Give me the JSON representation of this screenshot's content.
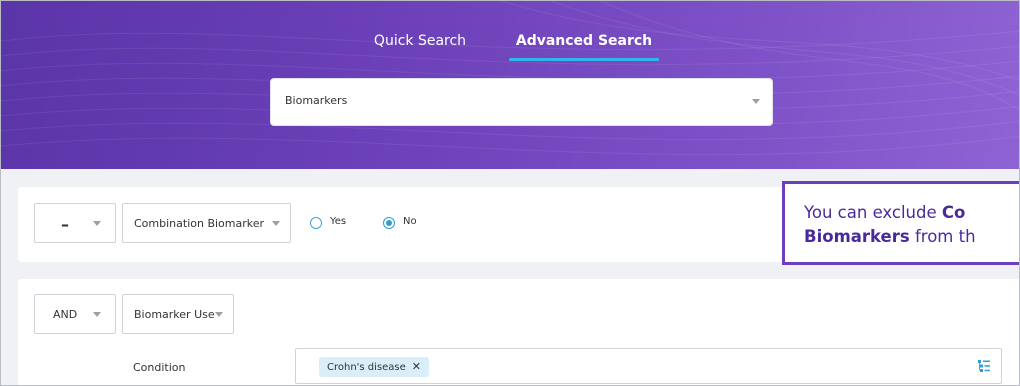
{
  "tabs": [
    {
      "label": "Quick Search",
      "active": false
    },
    {
      "label": "Advanced Search",
      "active": true
    }
  ],
  "search_type": {
    "value": "Biomarkers"
  },
  "row1": {
    "operator": "–",
    "field": "Combination Biomarker",
    "options": [
      {
        "label": "Yes",
        "selected": false
      },
      {
        "label": "No",
        "selected": true
      }
    ]
  },
  "row2": {
    "operator": "AND",
    "field": "Biomarker Use",
    "condition_label": "Condition",
    "condition_tag": "Crohn's disease",
    "tag_remove": "✕"
  },
  "callout": {
    "line1_prefix": "You can exclude ",
    "line1_bold": "Co",
    "line2_bold": "Biomarkers",
    "line2_suffix": " from th"
  },
  "colors": {
    "header_purple": "#6a3fb7",
    "accent_blue": "#2fb7ea",
    "callout_border": "#6b3fbf"
  }
}
